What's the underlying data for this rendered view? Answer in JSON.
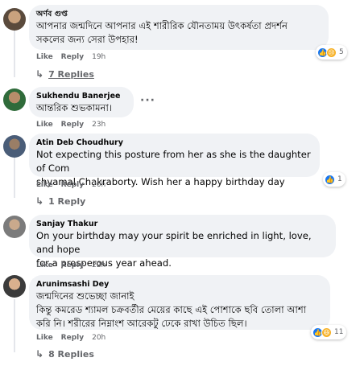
{
  "colors": {
    "bubble": "#f0f2f5",
    "meta": "#65676b",
    "like_blue": "#1877f2",
    "emoji_yellow": "#f7b125"
  },
  "comments": [
    {
      "author": "অর্ণব গুপ্ত",
      "text": "আপনার জন্মদিনে আপনার এই শারীরিক যৌনতাময় উৎকর্ষতা প্রদর্শন\nসকলের জন্য সেরা উপহার!",
      "like": "Like",
      "reply": "Reply",
      "time": "19h",
      "reactions": {
        "icons": [
          "like-icon",
          "sad-icon"
        ],
        "count": "5"
      },
      "replies": "7 Replies"
    },
    {
      "author": "Sukhendu Banerjee",
      "text": "আন্তরিক শুভকামনা।",
      "like": "Like",
      "reply": "Reply",
      "time": "23h"
    },
    {
      "author": "Atin Deb Choudhury",
      "text": "Not expecting this posture from her as she is the daughter of Com\nshyamal Chakraborty. Wish her a happy birthday day",
      "like": "Like",
      "reply": "Reply",
      "time": "20h",
      "reactions": {
        "icons": [
          "like-icon"
        ],
        "count": "1"
      },
      "replies": "1 Reply"
    },
    {
      "author": "Sanjay Thakur",
      "text": "On your birthday may your spirit be enriched in light, love, and hope\nfor a prosperous year ahead.",
      "like": "Like",
      "reply": "Reply",
      "time": "22h"
    },
    {
      "author": "Arunimsashi Dey",
      "text": "জন্মদিনের শুভেচ্ছা জানাই\nকিন্তু কমরেড শ্যামল চক্রবর্তীর মেয়ের কাছে এই পোশাকে ছবি তোলা আশা\nকরি নি। শরীরের নিম্নাংশ আরেকটু ঢেকে রাখা উচিত ছিল।",
      "like": "Like",
      "reply": "Reply",
      "time": "20h",
      "reactions": {
        "icons": [
          "like-icon",
          "haha-icon"
        ],
        "count": "11"
      },
      "replies": "8 Replies"
    }
  ]
}
